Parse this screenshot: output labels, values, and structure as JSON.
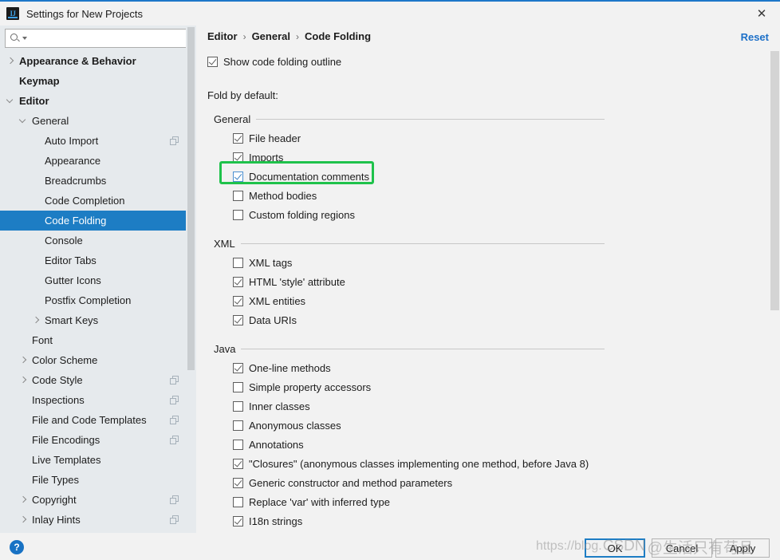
{
  "window": {
    "title": "Settings for New Projects",
    "app_icon": "intellij-idea-icon",
    "close_icon": "✕"
  },
  "search": {
    "value": "",
    "placeholder": "",
    "icon": "search-icon"
  },
  "sidebar": {
    "items": [
      {
        "label": "Appearance & Behavior",
        "indent": 0,
        "arrow": "right",
        "bold": true,
        "copy": false
      },
      {
        "label": "Keymap",
        "indent": 0,
        "arrow": "none",
        "bold": true,
        "copy": false
      },
      {
        "label": "Editor",
        "indent": 0,
        "arrow": "down",
        "bold": true,
        "copy": false
      },
      {
        "label": "General",
        "indent": 1,
        "arrow": "down",
        "bold": false,
        "copy": false
      },
      {
        "label": "Auto Import",
        "indent": 2,
        "arrow": "none",
        "bold": false,
        "copy": true
      },
      {
        "label": "Appearance",
        "indent": 2,
        "arrow": "none",
        "bold": false,
        "copy": false
      },
      {
        "label": "Breadcrumbs",
        "indent": 2,
        "arrow": "none",
        "bold": false,
        "copy": false
      },
      {
        "label": "Code Completion",
        "indent": 2,
        "arrow": "none",
        "bold": false,
        "copy": false
      },
      {
        "label": "Code Folding",
        "indent": 2,
        "arrow": "none",
        "bold": false,
        "copy": false,
        "selected": true
      },
      {
        "label": "Console",
        "indent": 2,
        "arrow": "none",
        "bold": false,
        "copy": false
      },
      {
        "label": "Editor Tabs",
        "indent": 2,
        "arrow": "none",
        "bold": false,
        "copy": false
      },
      {
        "label": "Gutter Icons",
        "indent": 2,
        "arrow": "none",
        "bold": false,
        "copy": false
      },
      {
        "label": "Postfix Completion",
        "indent": 2,
        "arrow": "none",
        "bold": false,
        "copy": false
      },
      {
        "label": "Smart Keys",
        "indent": 2,
        "arrow": "right",
        "bold": false,
        "copy": false
      },
      {
        "label": "Font",
        "indent": 1,
        "arrow": "none",
        "bold": false,
        "copy": false
      },
      {
        "label": "Color Scheme",
        "indent": 1,
        "arrow": "right",
        "bold": false,
        "copy": false
      },
      {
        "label": "Code Style",
        "indent": 1,
        "arrow": "right",
        "bold": false,
        "copy": true
      },
      {
        "label": "Inspections",
        "indent": 1,
        "arrow": "none",
        "bold": false,
        "copy": true
      },
      {
        "label": "File and Code Templates",
        "indent": 1,
        "arrow": "none",
        "bold": false,
        "copy": true
      },
      {
        "label": "File Encodings",
        "indent": 1,
        "arrow": "none",
        "bold": false,
        "copy": true
      },
      {
        "label": "Live Templates",
        "indent": 1,
        "arrow": "none",
        "bold": false,
        "copy": false
      },
      {
        "label": "File Types",
        "indent": 1,
        "arrow": "none",
        "bold": false,
        "copy": false
      },
      {
        "label": "Copyright",
        "indent": 1,
        "arrow": "right",
        "bold": false,
        "copy": true
      },
      {
        "label": "Inlay Hints",
        "indent": 1,
        "arrow": "right",
        "bold": false,
        "copy": true
      }
    ]
  },
  "main": {
    "breadcrumb": [
      "Editor",
      "General",
      "Code Folding"
    ],
    "breadcrumb_separator": "›",
    "reset_label": "Reset",
    "show_outline": {
      "label": "Show code folding outline",
      "checked": true
    },
    "fold_by_default_label": "Fold by default:",
    "groups": [
      {
        "title": "General",
        "options": [
          {
            "label": "File header",
            "checked": true
          },
          {
            "label": "Imports",
            "checked": true
          },
          {
            "label": "Documentation comments",
            "checked": true,
            "highlighted": true
          },
          {
            "label": "Method bodies",
            "checked": false
          },
          {
            "label": "Custom folding regions",
            "checked": false
          }
        ]
      },
      {
        "title": "XML",
        "options": [
          {
            "label": "XML tags",
            "checked": false
          },
          {
            "label": "HTML 'style' attribute",
            "checked": true
          },
          {
            "label": "XML entities",
            "checked": true
          },
          {
            "label": "Data URIs",
            "checked": true
          }
        ]
      },
      {
        "title": "Java",
        "options": [
          {
            "label": "One-line methods",
            "checked": true
          },
          {
            "label": "Simple property accessors",
            "checked": false
          },
          {
            "label": "Inner classes",
            "checked": false
          },
          {
            "label": "Anonymous classes",
            "checked": false
          },
          {
            "label": "Annotations",
            "checked": false
          },
          {
            "label": "\"Closures\" (anonymous classes implementing one method, before Java 8)",
            "checked": true
          },
          {
            "label": "Generic constructor and method parameters",
            "checked": true
          },
          {
            "label": "Replace 'var' with inferred type",
            "checked": false
          },
          {
            "label": "I18n strings",
            "checked": true
          }
        ]
      }
    ]
  },
  "footer": {
    "help_icon_label": "?",
    "buttons": [
      {
        "id": "ok",
        "label": "OK",
        "primary": true
      },
      {
        "id": "cancel",
        "label": "Cancel",
        "primary": false
      },
      {
        "id": "apply",
        "label": "Apply",
        "primary": false
      }
    ]
  },
  "watermark": {
    "url": "https://blog.",
    "brand": "CSDN",
    "chinese": "@生活只有苟且"
  },
  "colors": {
    "accent": "#1d7dc4",
    "selection": "#1d7dc4",
    "highlight": "#1fc24b",
    "link": "#1d70c8",
    "sidebar_bg": "#e6eaed",
    "panel_bg": "#f2f2f2"
  }
}
